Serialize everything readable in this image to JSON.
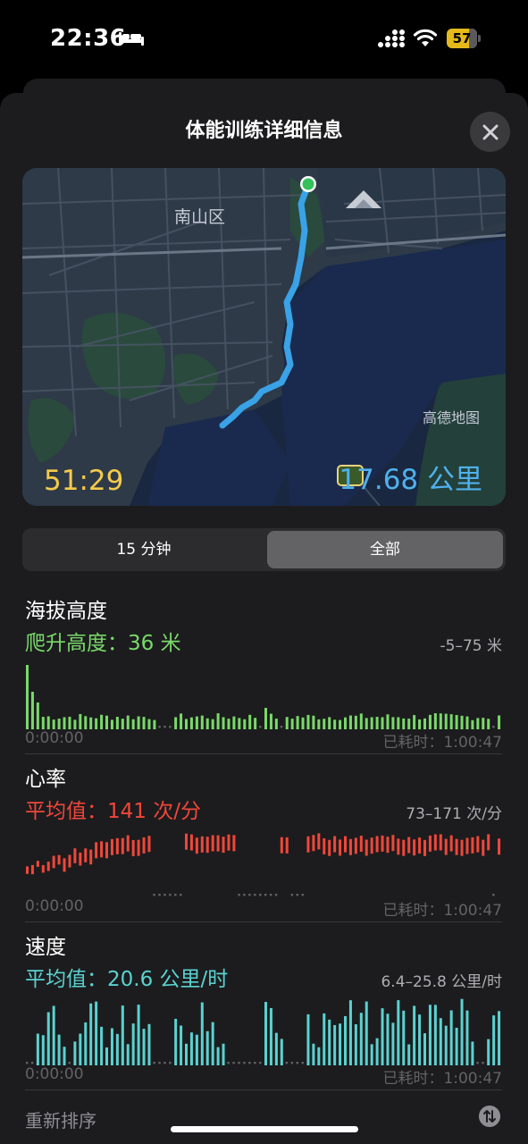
{
  "status_bar": {
    "time": "22:36",
    "battery": "57"
  },
  "sheet": {
    "title": "体能训练详细信息"
  },
  "map": {
    "labels": [
      "南山区",
      "高德地图"
    ],
    "duration": "51:29",
    "distance": "17.68 公里"
  },
  "segmented": {
    "options": [
      "15 分钟",
      "全部"
    ],
    "selected": "全部"
  },
  "elevation": {
    "title": "海拔高度",
    "summary": "爬升高度：36 米",
    "range": "-5–75 米",
    "start": "0:00:00",
    "end": "已耗时：1:00:47",
    "color": "#7ad96a"
  },
  "heart_rate": {
    "title": "心率",
    "summary": "平均值：141 次/分",
    "range": "73–171 次/分",
    "start": "0:00:00",
    "end": "已耗时：1:00:47",
    "color": "#f0473a"
  },
  "speed": {
    "title": "速度",
    "summary": "平均值：20.6 公里/时",
    "range": "6.4–25.8 公里/时",
    "start": "0:00:00",
    "end": "已耗时：1:00:47",
    "color": "#5ad2d0"
  },
  "footer": {
    "reorder": "重新排序"
  }
}
